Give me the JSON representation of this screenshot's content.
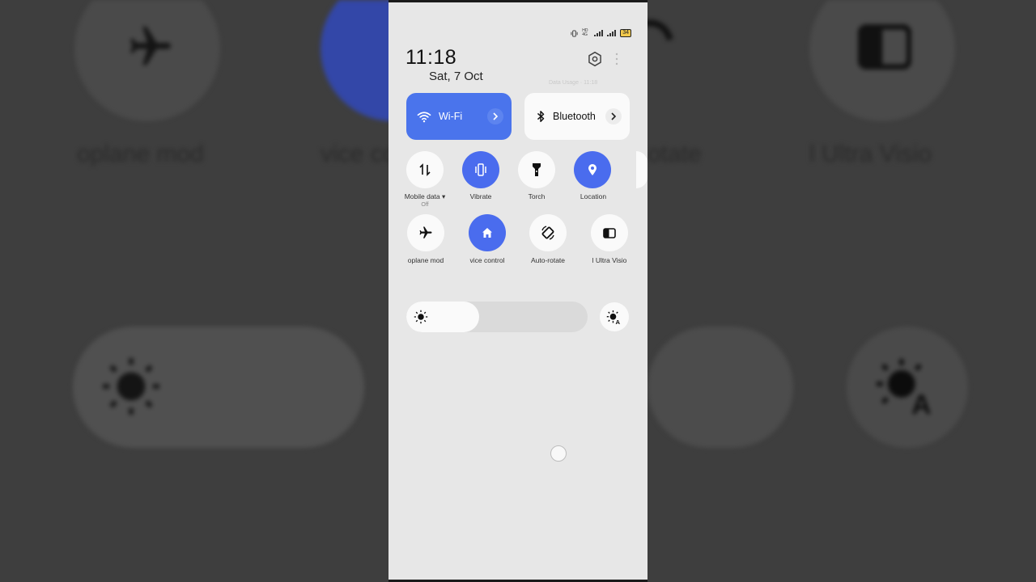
{
  "background": {
    "labels": [
      "oplane mod",
      "vice co",
      "otate",
      "l Ultra Visio"
    ]
  },
  "status_bar": {
    "network": "HD 4G",
    "battery": "34"
  },
  "header": {
    "time": "11:18",
    "date": "Sat, 7 Oct",
    "faint_text": "Data Usage · 11:18"
  },
  "big_tiles": [
    {
      "label": "Wi-Fi",
      "state": "on",
      "icon": "wifi-icon"
    },
    {
      "label": "Bluetooth",
      "state": "off",
      "icon": "bluetooth-icon"
    }
  ],
  "quick_tiles_row1": [
    {
      "label": "Mobile data ▾",
      "sublabel": "Off",
      "state": "off",
      "icon": "mobile-data-icon"
    },
    {
      "label": "Vibrate",
      "state": "on",
      "icon": "vibrate-icon"
    },
    {
      "label": "Torch",
      "state": "off",
      "icon": "torch-icon"
    },
    {
      "label": "Location",
      "state": "on",
      "icon": "location-icon"
    }
  ],
  "quick_tiles_row2": [
    {
      "label": "oplane mod",
      "state": "off",
      "icon": "airplane-icon"
    },
    {
      "label": "vice control",
      "state": "on",
      "icon": "home-icon"
    },
    {
      "label": "Auto-rotate",
      "state": "off",
      "icon": "auto-rotate-icon"
    },
    {
      "label": "l Ultra Visio",
      "state": "off",
      "icon": "ultra-vision-icon"
    }
  ],
  "brightness": {
    "level_percent": 40
  },
  "colors": {
    "accent": "#4a6cee",
    "wifi_tile": "#4a74ec",
    "panel": "#e7e7e7",
    "tile_off": "#fafafa"
  }
}
